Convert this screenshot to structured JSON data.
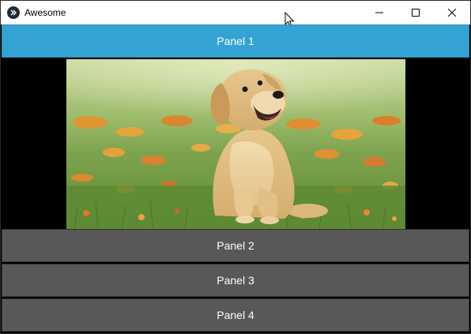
{
  "window": {
    "title": "Awesome",
    "minimize_icon": "minimize-icon",
    "maximize_icon": "maximize-icon",
    "close_icon": "close-icon"
  },
  "accordion": {
    "panels": [
      {
        "label": "Panel 1",
        "expanded": true,
        "content": "puppy-photo"
      },
      {
        "label": "Panel 2",
        "expanded": false
      },
      {
        "label": "Panel 3",
        "expanded": false
      },
      {
        "label": "Panel 4",
        "expanded": false
      }
    ]
  },
  "colors": {
    "active_header": "#33a3d3",
    "inactive_header": "#585858",
    "content_background": "#000000",
    "header_text": "#ffffff"
  }
}
